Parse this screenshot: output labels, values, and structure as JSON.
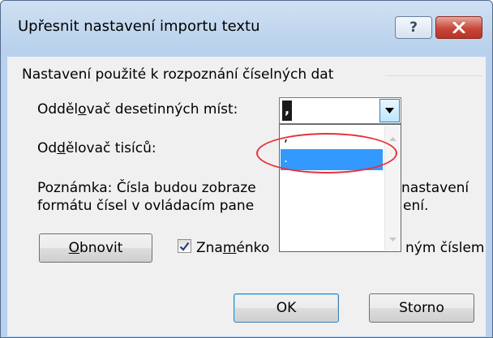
{
  "window": {
    "title": "Upřesnit nastavení importu textu",
    "help_label": "?",
    "close_icon": "close-icon"
  },
  "group": {
    "label": "Nastavení použité k rozpoznání číselných dat"
  },
  "decimal_separator": {
    "label_before": "Odděl",
    "label_accel": "o",
    "label_after": "vač desetinných míst:",
    "value": ",",
    "options": [
      ",",
      "."
    ],
    "selected_option": "."
  },
  "thousands_separator": {
    "label_before": "Od",
    "label_accel": "d",
    "label_after": "ělovač tisíců:"
  },
  "note": {
    "line1_left": "Poznámka: Čísla budou zobraze",
    "line1_right": "nastavení",
    "line2_left": "formátu čísel v ovládacím pane",
    "line2_right": "ení."
  },
  "buttons": {
    "reset_accel": "O",
    "reset_rest": "bnovit",
    "ok": "OK",
    "cancel": "Storno"
  },
  "sign_checkbox": {
    "checked": true,
    "label_before": "Zna",
    "label_accel": "m",
    "label_after": "énko",
    "label_right": "ným číslem"
  },
  "colors": {
    "annotation": "#e8303a",
    "selection": "#3399ff"
  }
}
